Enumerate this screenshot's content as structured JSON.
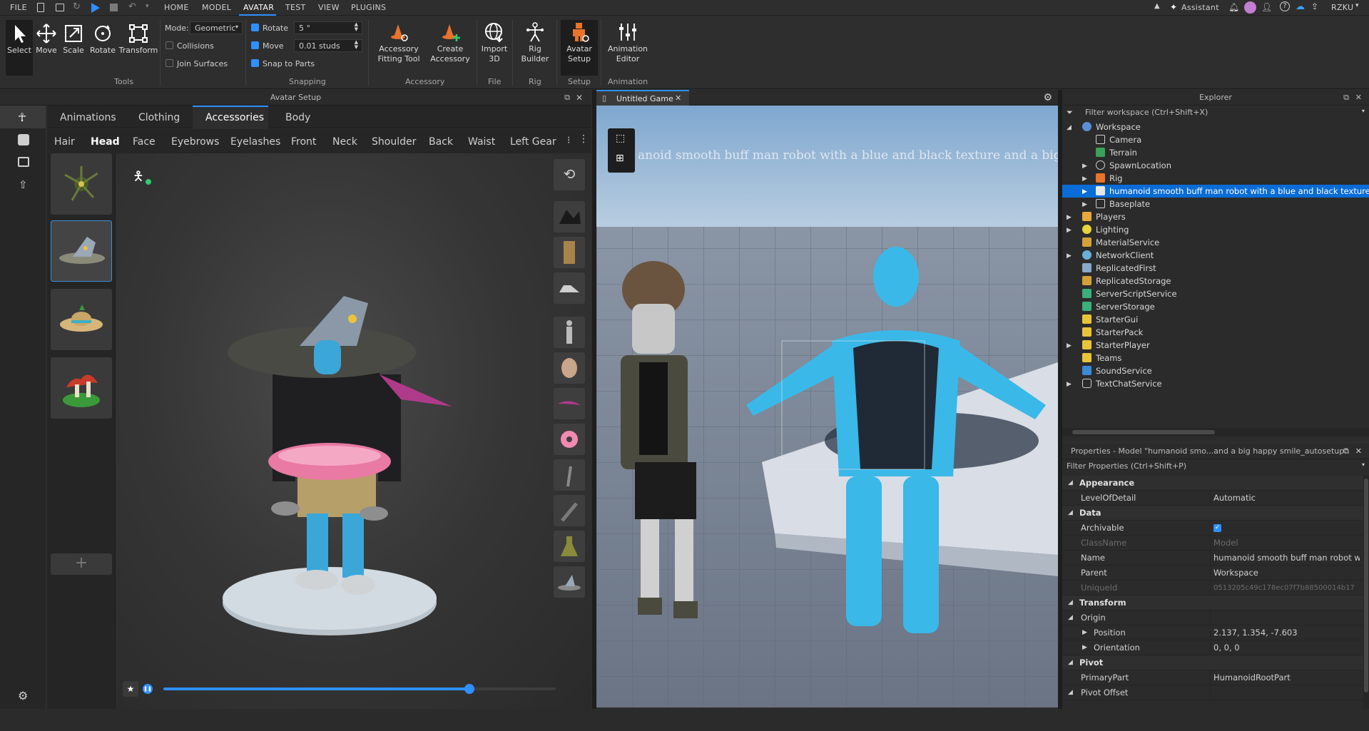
{
  "menubar": {
    "file": "FILE",
    "tabs": [
      "HOME",
      "MODEL",
      "AVATAR",
      "TEST",
      "VIEW",
      "PLUGINS"
    ],
    "assistant": "Assistant",
    "user": "RZKU"
  },
  "ribbon": {
    "tools": {
      "select": "Select",
      "move": "Move",
      "scale": "Scale",
      "rotate": "Rotate",
      "transform": "Transform",
      "group": "Tools"
    },
    "mode_label": "Mode:",
    "mode_value": "Geometric",
    "collisions": "Collisions",
    "join_surfaces": "Join Surfaces",
    "rotate": "Rotate",
    "rotate_value": "5 °",
    "move": "Move",
    "move_value": "0.01 studs",
    "snap_to_parts": "Snap to Parts",
    "snapping_group": "Snapping",
    "accessory_fitting_1": "Accessory",
    "accessory_fitting_2": "Fitting Tool",
    "create_accessory_1": "Create",
    "create_accessory_2": "Accessory",
    "accessory_group": "Accessory",
    "import3d_1": "Import",
    "import3d_2": "3D",
    "file_group": "File",
    "rig_builder_1": "Rig",
    "rig_builder_2": "Builder",
    "rig_group": "Rig",
    "avatar_setup_1": "Avatar",
    "avatar_setup_2": "Setup",
    "setup_group": "Setup",
    "animation_editor_1": "Animation",
    "animation_editor_2": "Editor",
    "animation_group": "Animation"
  },
  "avatar_setup": {
    "title": "Avatar Setup",
    "tabs": [
      "Animations",
      "Clothing",
      "Accessories",
      "Body"
    ],
    "subtabs": [
      "Hair",
      "Head",
      "Face",
      "Eyebrows",
      "Eyelashes",
      "Front",
      "Neck",
      "Shoulder",
      "Back",
      "Waist",
      "Left Gear"
    ],
    "timeline_progress": 0.78
  },
  "game": {
    "tab_title": "Untitled Game",
    "floating_label": "anoid smooth buff man robot with a blue and black texture and a big h"
  },
  "explorer": {
    "title": "Explorer",
    "filter": "Filter workspace (Ctrl+Shift+X)",
    "items": [
      {
        "label": "Workspace"
      },
      {
        "label": "Camera"
      },
      {
        "label": "Terrain"
      },
      {
        "label": "SpawnLocation"
      },
      {
        "label": "Rig"
      },
      {
        "label": "humanoid smooth buff man robot with a blue and black texture and a b"
      },
      {
        "label": "Baseplate"
      },
      {
        "label": "Players"
      },
      {
        "label": "Lighting"
      },
      {
        "label": "MaterialService"
      },
      {
        "label": "NetworkClient"
      },
      {
        "label": "ReplicatedFirst"
      },
      {
        "label": "ReplicatedStorage"
      },
      {
        "label": "ServerScriptService"
      },
      {
        "label": "ServerStorage"
      },
      {
        "label": "StarterGui"
      },
      {
        "label": "StarterPack"
      },
      {
        "label": "StarterPlayer"
      },
      {
        "label": "Teams"
      },
      {
        "label": "SoundService"
      },
      {
        "label": "TextChatService"
      }
    ]
  },
  "properties": {
    "title": "Properties - Model \"humanoid smo...and a big happy smile_autosetup\"",
    "filter": "Filter Properties (Ctrl+Shift+P)",
    "rows": [
      {
        "k": "Appearance",
        "v": ""
      },
      {
        "k": "LevelOfDetail",
        "v": "Automatic"
      },
      {
        "k": "Data",
        "v": ""
      },
      {
        "k": "Archivable",
        "v": ""
      },
      {
        "k": "ClassName",
        "v": "Model"
      },
      {
        "k": "Name",
        "v": "humanoid smooth buff man robot w..."
      },
      {
        "k": "Parent",
        "v": "Workspace"
      },
      {
        "k": "UniqueId",
        "v": "0513205c49c178ec07f7b88500014b17"
      },
      {
        "k": "Transform",
        "v": ""
      },
      {
        "k": "Origin",
        "v": ""
      },
      {
        "k": "Position",
        "v": "2.137, 1.354, -7.603"
      },
      {
        "k": "Orientation",
        "v": "0, 0, 0"
      },
      {
        "k": "Pivot",
        "v": ""
      },
      {
        "k": "PrimaryPart",
        "v": "HumanoidRootPart"
      },
      {
        "k": "Pivot Offset",
        "v": ""
      }
    ]
  },
  "colors": {
    "accent": "#2f8fff",
    "selection": "#0a6cd6",
    "panel": "#2b2b2b"
  }
}
